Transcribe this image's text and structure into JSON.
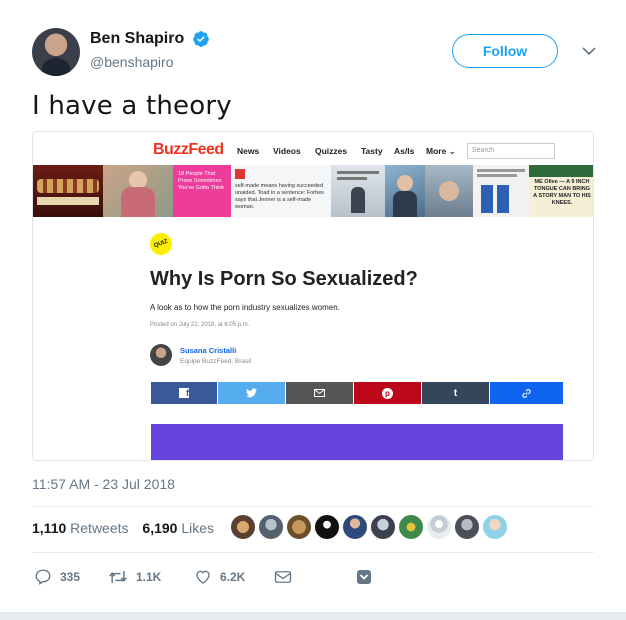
{
  "user": {
    "display_name": "Ben Shapiro",
    "handle": "@benshapiro",
    "verified": true
  },
  "follow_label": "Follow",
  "tweet_text": "I have a theory",
  "card": {
    "site": {
      "logo": "BuzzFeed",
      "nav": [
        "News",
        "Videos",
        "Quizzes",
        "Tasty",
        "As/Is",
        "More ⌄"
      ],
      "search_placeholder": "Search"
    },
    "thumbnails": [
      {
        "text": "18 People That Prove Sometimes You've Gotta Think"
      },
      {
        "text": "self-made means having succeeded unaided. Toad in a sentence: Forbes says that Jenner is a self-made woman."
      },
      {
        "text": "ME Olive — A 9 INCH TONGUE CAN BRING A STORY MAN TO HIS KNEES."
      }
    ],
    "quiz_badge": "QUIZ",
    "title": "Why Is Porn So Sexualized?",
    "subtitle": "A look as to how the porn industry sexualizes women.",
    "posted": "Posted on July 22, 2018, at 6:05 p.m.",
    "author": {
      "name": "Susana Cristalli",
      "role": "Equipe BuzzFeed, Brasil"
    },
    "share_colors": {
      "facebook": "#3b5998",
      "twitter": "#55acee",
      "email": "#555555",
      "pinterest": "#bd081c",
      "tumblr": "#35465c",
      "link": "#0f65ef"
    },
    "accent_purple": "#6645dd"
  },
  "timestamp": "11:57 AM - 23 Jul 2018",
  "stats": {
    "retweets_count": "1,110",
    "retweets_label": "Retweets",
    "likes_count": "6,190",
    "likes_label": "Likes"
  },
  "actions": {
    "reply_count": "335",
    "retweet_count": "1.1K",
    "like_count": "6.2K"
  },
  "colors": {
    "brand_blue": "#1da1f2",
    "secondary_text": "#657786"
  }
}
